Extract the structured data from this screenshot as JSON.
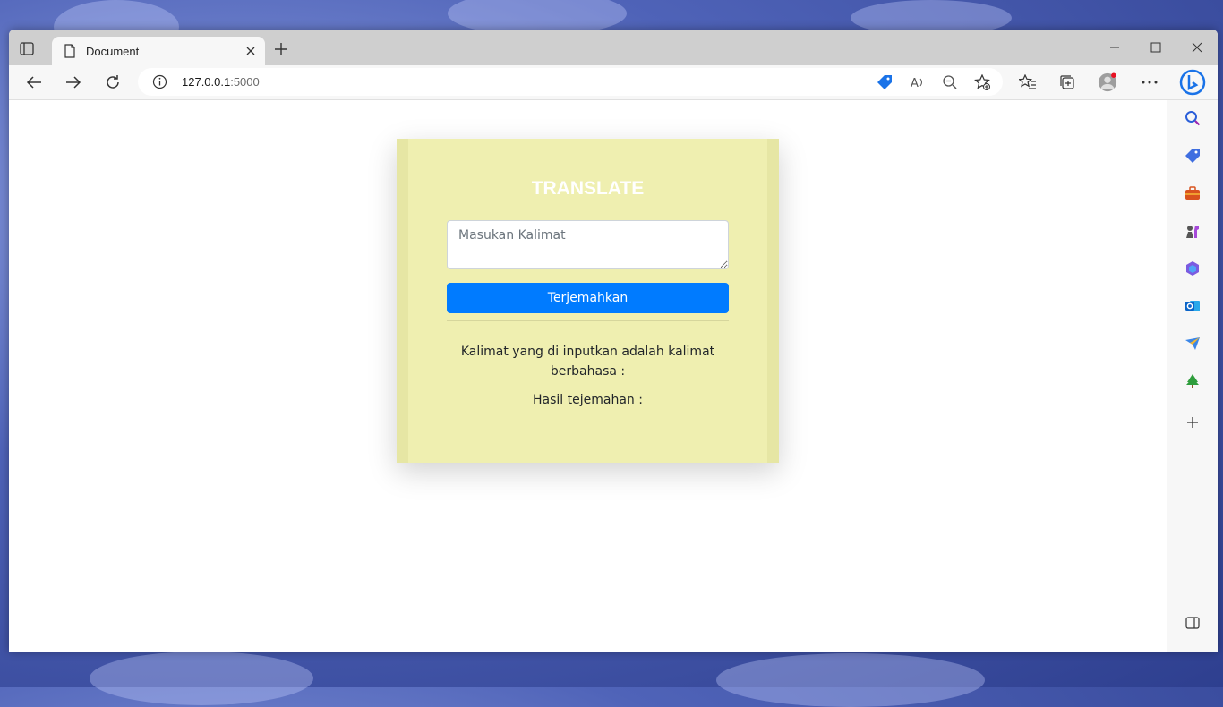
{
  "browser": {
    "tab_title": "Document",
    "url_host": "127.0.0.1",
    "url_port": ":5000"
  },
  "page": {
    "heading": "TRANSLATE",
    "input_placeholder": "Masukan Kalimat",
    "translate_button": "Terjemahkan",
    "detected_language_text": "Kalimat yang di inputkan adalah kalimat berbahasa :",
    "translation_result_text": "Hasil tejemahan :"
  },
  "colors": {
    "card_background": "#efefb0",
    "button_accent": "#007bff",
    "heading_text": "#ffffff"
  },
  "sidebar_icons": [
    "search-icon",
    "shopping-tag-icon",
    "tools-icon",
    "games-icon",
    "office-icon",
    "outlook-icon",
    "send-icon",
    "tree-icon",
    "add-icon",
    "split-screen-icon",
    "settings-icon"
  ]
}
